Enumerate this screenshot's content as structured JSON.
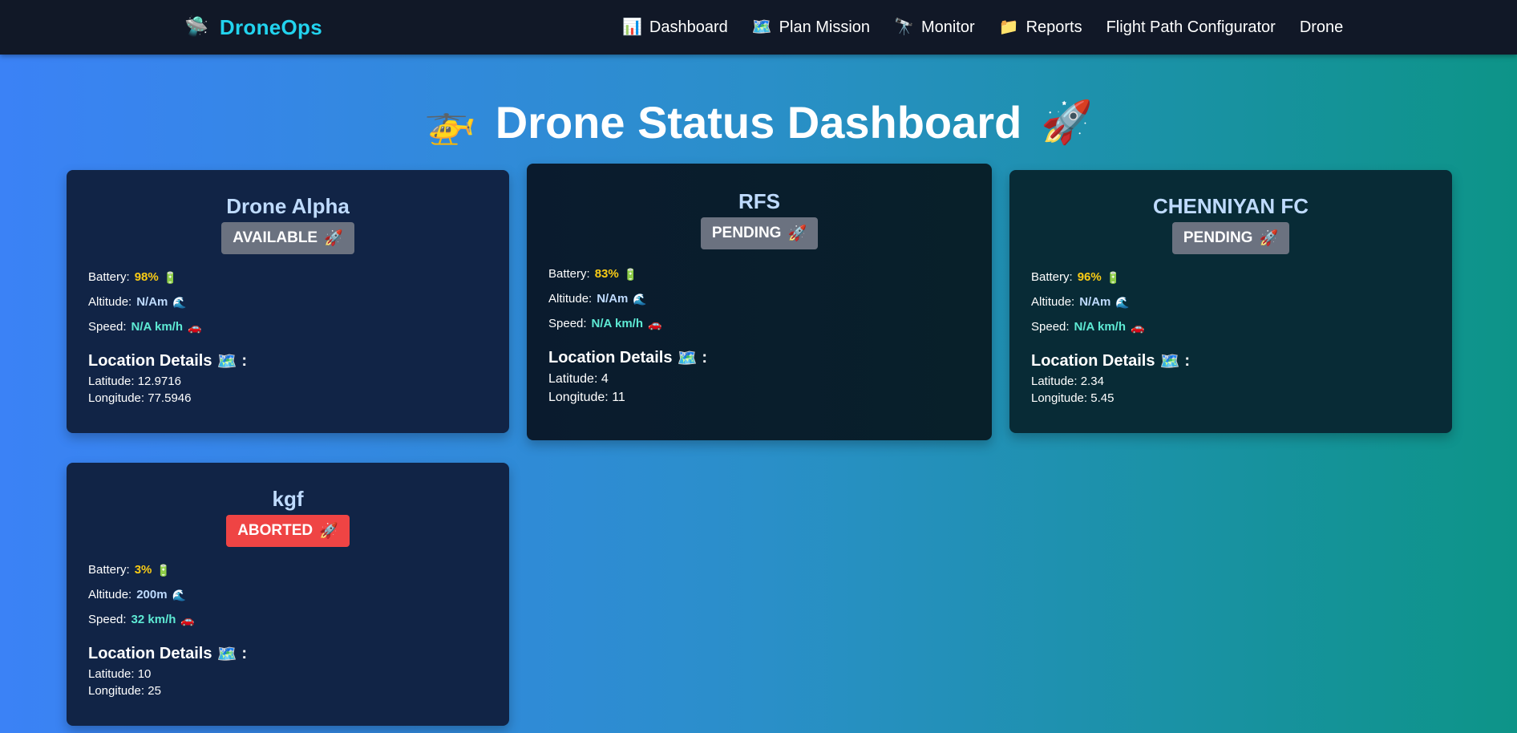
{
  "nav": {
    "brand_icon": "🛸",
    "brand_name": "DroneOps",
    "links": [
      {
        "icon": "📊",
        "label": "Dashboard"
      },
      {
        "icon": "🗺️",
        "label": "Plan Mission"
      },
      {
        "icon": "🔭",
        "label": "Monitor"
      },
      {
        "icon": "📁",
        "label": "Reports"
      },
      {
        "icon": "",
        "label": "Flight Path Configurator"
      },
      {
        "icon": "",
        "label": "Drone"
      }
    ]
  },
  "page": {
    "title": "Drone Status Dashboard",
    "title_icon_left": "🚁",
    "title_icon_right": "🚀"
  },
  "labels": {
    "battery": "Battery:",
    "altitude": "Altitude:",
    "speed": "Speed:",
    "location_details": "Location Details",
    "latitude": "Latitude:",
    "longitude": "Longitude:",
    "battery_icon": "🔋",
    "altitude_icon": "🌊",
    "speed_icon": "🚗",
    "map_icon": "🗺️",
    "status_icon": "🚀"
  },
  "drones": [
    {
      "name": "Drone Alpha",
      "status": "AVAILABLE",
      "battery": "98%",
      "altitude": "N/Am",
      "speed": "N/A km/h",
      "latitude": "12.9716",
      "longitude": "77.5946"
    },
    {
      "name": "RFS",
      "status": "PENDING",
      "battery": "83%",
      "altitude": "N/Am",
      "speed": "N/A km/h",
      "latitude": "4",
      "longitude": "11"
    },
    {
      "name": "CHENNIYAN FC",
      "status": "PENDING",
      "battery": "96%",
      "altitude": "N/Am",
      "speed": "N/A km/h",
      "latitude": "2.34",
      "longitude": "5.45"
    },
    {
      "name": "kgf",
      "status": "ABORTED",
      "battery": "3%",
      "altitude": "200m",
      "speed": "32 km/h",
      "latitude": "10",
      "longitude": "25"
    }
  ],
  "colors": {
    "brand": "#22d3ee",
    "nav_bg": "#111827",
    "badge_gray": "#6b7280",
    "badge_aborted": "#ef4444",
    "battery_value": "#facc15",
    "speed_value": "#5eead4"
  }
}
